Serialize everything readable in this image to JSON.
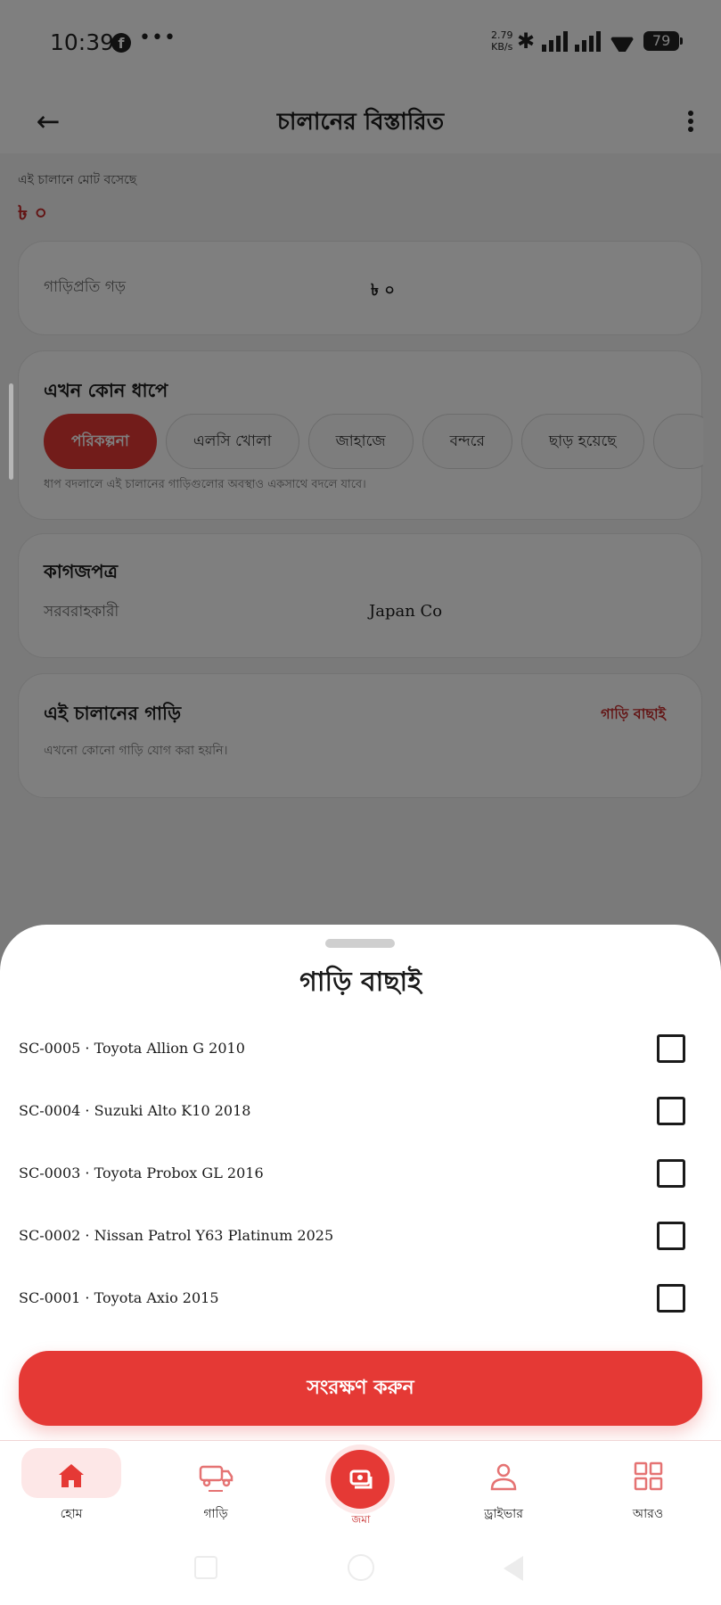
{
  "status_bar": {
    "time": "10:39",
    "notif_icon": "facebook-icon",
    "more_notifications": "•••",
    "speed_value": "2.79",
    "speed_unit": "KB/s",
    "battery": "79"
  },
  "app_bar": {
    "title": "চালানের বিস্তারিত",
    "back_icon": "←",
    "menu_icon": "more-vert-icon"
  },
  "summary": {
    "total_label": "এই চালানে মোট বসেছে",
    "total_value": "৳ ০"
  },
  "cost_card": {
    "label": "গাড়িপ্রতি গড়",
    "value": "৳ ০"
  },
  "stage_card": {
    "title": "এখন কোন ধাপে",
    "stages": [
      "পরিকল্পনা",
      "এলসি খোলা",
      "জাহাজে",
      "বন্দরে",
      "ছাড় হয়েছে"
    ],
    "active_stage": "পরিকল্পনা",
    "note": "ধাপ বদলালে এই চালানের গাড়িগুলোর অবস্থাও একসাথে বদলে যাবে।"
  },
  "docs_card": {
    "title": "কাগজপত্র",
    "supplier_label": "সরবরাহকারী",
    "supplier_value": "Japan Co"
  },
  "cars_card": {
    "title": "এই চালানের গাড়ি",
    "select_link": "গাড়ি বাছাই",
    "empty_text": "এখনো কোনো গাড়ি যোগ করা হয়নি।"
  },
  "sheet": {
    "title": "গাড়ি বাছাই",
    "cars": [
      {
        "label": "SC-0005 · Toyota Allion G 2010",
        "checked": false
      },
      {
        "label": "SC-0004 · Suzuki Alto K10 2018",
        "checked": false
      },
      {
        "label": "SC-0003 · Toyota Probox GL 2016",
        "checked": false
      },
      {
        "label": "SC-0002 · Nissan Patrol Y63 Platinum 2025",
        "checked": false
      },
      {
        "label": "SC-0001 · Toyota Axio 2015",
        "checked": false
      }
    ],
    "save_label": "সংরক্ষণ করুন"
  },
  "bottom_nav": {
    "items": [
      {
        "label": "হোম",
        "icon": "home-icon",
        "active": true
      },
      {
        "label": "গাড়ি",
        "icon": "car-transport-icon",
        "active": false
      },
      {
        "label": "জমা",
        "icon": "cash-icon",
        "active": false
      },
      {
        "label": "ড্রাইভার",
        "icon": "person-icon",
        "active": false
      },
      {
        "label": "আরও",
        "icon": "grid-icon",
        "active": false
      }
    ]
  },
  "colors": {
    "accent": "#e53935",
    "accent_dark": "#c62828",
    "accent_soft": "#fde7e7"
  }
}
